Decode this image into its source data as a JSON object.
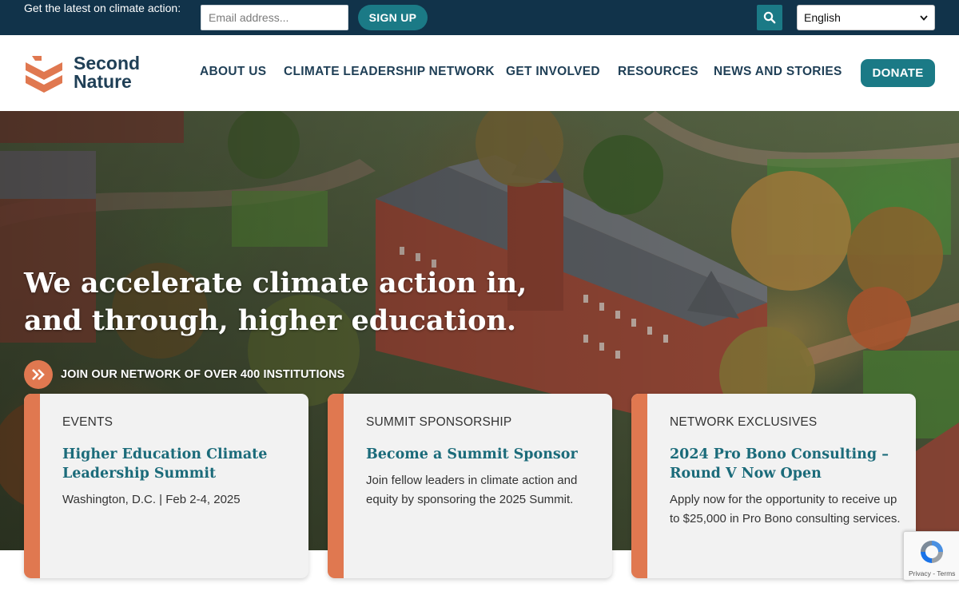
{
  "topbar": {
    "newsletter_text": "Get the latest on climate action:",
    "email_placeholder": "Email address...",
    "signup_label": "SIGN UP",
    "search_icon": "search-icon",
    "language_selected": "English"
  },
  "header": {
    "logo_line1": "Second",
    "logo_line2": "Nature",
    "nav": [
      {
        "label": "ABOUT US"
      },
      {
        "label": "CLIMATE LEADERSHIP NETWORK"
      },
      {
        "label": "GET INVOLVED"
      },
      {
        "label": "RESOURCES"
      },
      {
        "label": "NEWS AND STORIES"
      }
    ],
    "donate_label": "DONATE"
  },
  "hero": {
    "headline": "We accelerate climate action in, and through, higher education.",
    "cta_label": "JOIN OUR NETWORK OF OVER 400 INSTITUTIONS"
  },
  "cards": [
    {
      "eyebrow": "EVENTS",
      "title": "Higher Education Climate Leadership Summit",
      "body": "Washington, D.C. | Feb 2-4, 2025"
    },
    {
      "eyebrow": "SUMMIT SPONSORSHIP",
      "title": "Become a Summit Sponsor",
      "body": "Join fellow leaders in climate action and equity by sponsoring the 2025 Summit."
    },
    {
      "eyebrow": "NETWORK EXCLUSIVES",
      "title": "2024 Pro Bono Consulting – Round V Now Open",
      "body": "Apply now for the opportunity to receive up to $25,000 in Pro Bono consulting services."
    }
  ],
  "recaptcha": {
    "links": "Privacy - Terms"
  },
  "colors": {
    "topbar_bg": "#11334a",
    "accent_teal": "#1b7a86",
    "accent_orange": "#e07850",
    "navy_text": "#1f3f56"
  }
}
